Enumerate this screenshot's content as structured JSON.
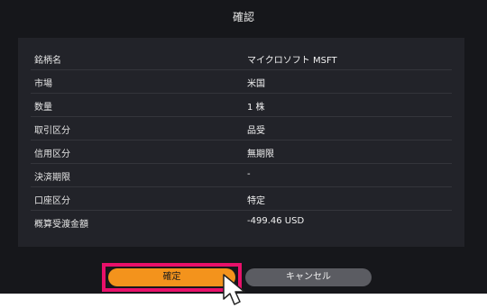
{
  "dialog": {
    "title": "確認",
    "rows": [
      {
        "label": "銘柄名",
        "value": "マイクロソフト MSFT"
      },
      {
        "label": "市場",
        "value": "米国"
      },
      {
        "label": "数量",
        "value": "1 株"
      },
      {
        "label": "取引区分",
        "value": "品受"
      },
      {
        "label": "信用区分",
        "value": "無期限"
      },
      {
        "label": "決済期限",
        "value": "-"
      },
      {
        "label": "口座区分",
        "value": "特定"
      },
      {
        "label": "概算受渡金額",
        "value": "-499.46 USD"
      }
    ],
    "confirm_label": "確定",
    "cancel_label": "キャンセル"
  },
  "colors": {
    "background": "#16171b",
    "panel": "#222329",
    "confirm": "#f3931c",
    "cancel": "#5b5c62",
    "highlight": "#e8106a"
  },
  "icons": [
    "mouse-pointer-icon"
  ]
}
